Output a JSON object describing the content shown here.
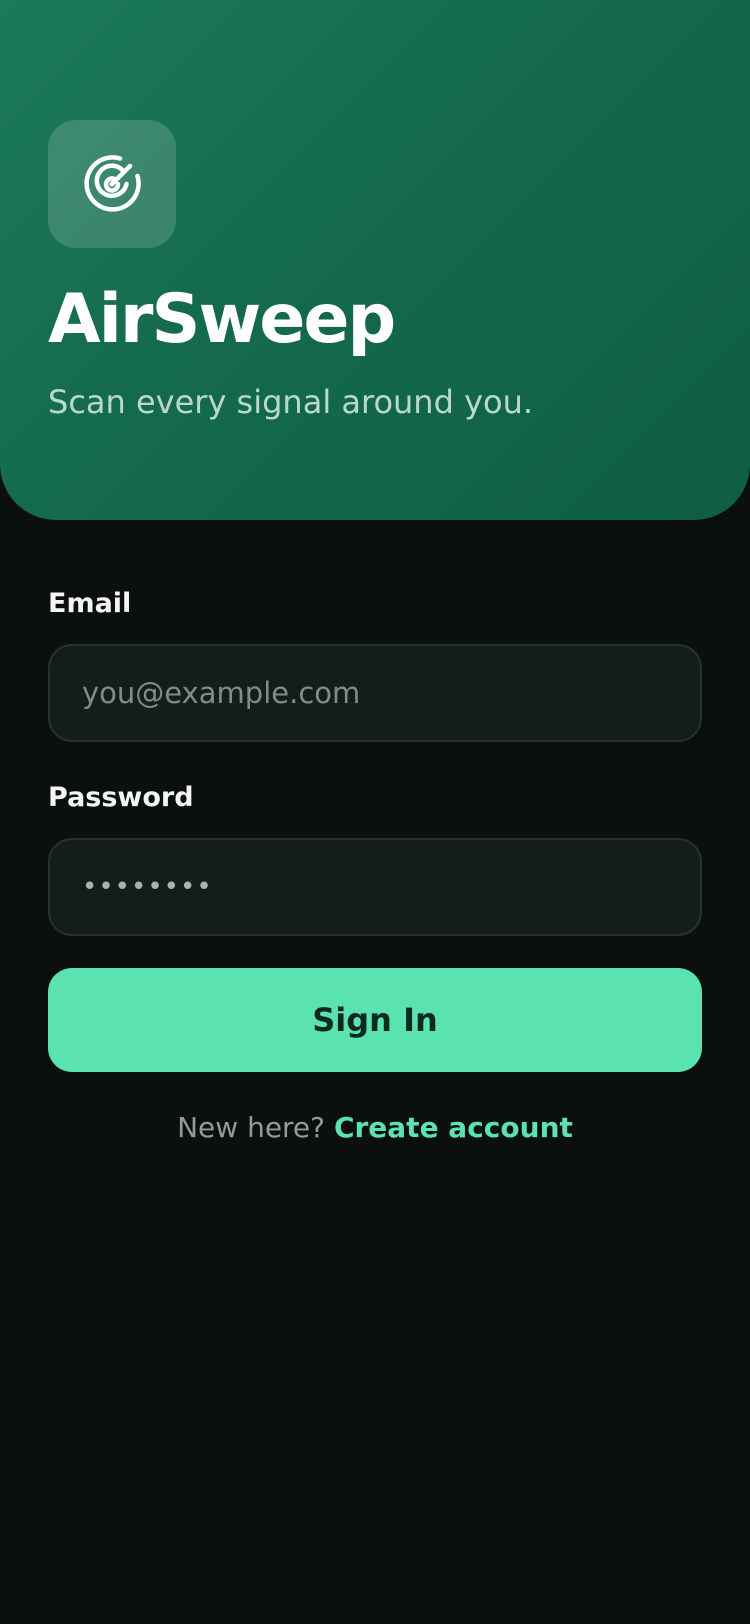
{
  "app": {
    "name": "AirSweep",
    "tagline": "Scan every signal around you.",
    "logo_icon": "radar-icon"
  },
  "form": {
    "email": {
      "label": "Email",
      "placeholder": "you@example.com",
      "value": ""
    },
    "password": {
      "label": "Password",
      "masked_value": "••••••••"
    },
    "submit_label": "Sign In"
  },
  "footer": {
    "prompt": "New here?",
    "link_label": "Create account"
  },
  "colors": {
    "hero_gradient_start": "#1b7a57",
    "hero_gradient_end": "#0f5e42",
    "background": "#0b100f",
    "accent": "#5ae3b1",
    "input_background": "#141d1b",
    "input_border": "#223430"
  }
}
